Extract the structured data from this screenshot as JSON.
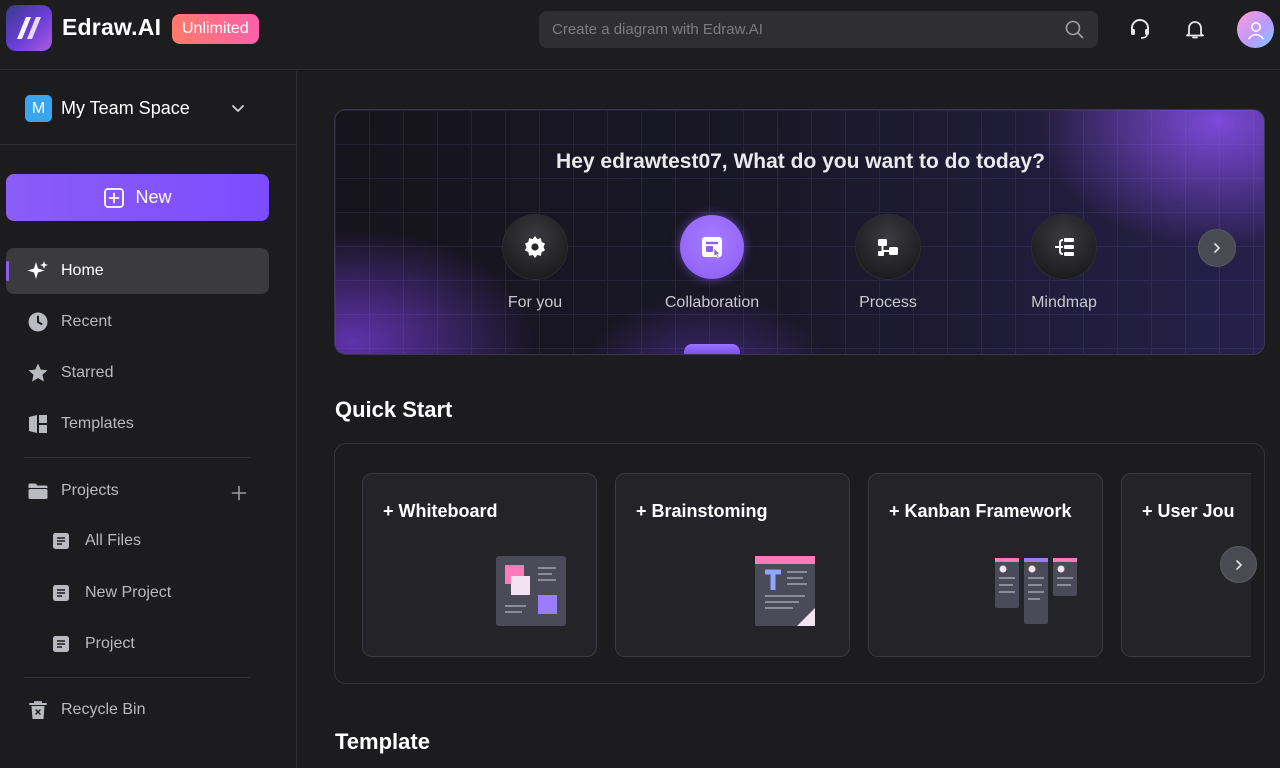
{
  "app": {
    "name": "Edraw.AI",
    "plan_badge": "Unlimited",
    "logo_icon": "edraw-logo-icon"
  },
  "search": {
    "placeholder": "Create a diagram with Edraw.AI",
    "icon": "search-icon"
  },
  "header_icons": [
    "support-headset-icon",
    "notification-bell-icon",
    "user-avatar"
  ],
  "sidebar": {
    "team": {
      "initial": "M",
      "name": "My Team Space"
    },
    "new_button": "New",
    "nav": [
      {
        "label": "Home",
        "icon": "sparkle-icon",
        "active": true
      },
      {
        "label": "Recent",
        "icon": "clock-icon"
      },
      {
        "label": "Starred",
        "icon": "star-icon"
      },
      {
        "label": "Templates",
        "icon": "templates-icon"
      }
    ],
    "projects": {
      "label": "Projects",
      "icon": "folder-icon",
      "items": [
        {
          "label": "All Files",
          "icon": "file-icon"
        },
        {
          "label": "New Project",
          "icon": "file-icon"
        },
        {
          "label": "Project",
          "icon": "file-icon"
        }
      ]
    },
    "recycle_bin": {
      "label": "Recycle Bin",
      "icon": "trash-icon"
    }
  },
  "hero": {
    "greeting": "Hey edrawtest07, What do you want to do today?",
    "features": [
      {
        "label": "For you",
        "icon": "gear-icon",
        "selected": false
      },
      {
        "label": "Collaboration",
        "icon": "collaboration-icon",
        "selected": true
      },
      {
        "label": "Process",
        "icon": "process-icon",
        "selected": false
      },
      {
        "label": "Mindmap",
        "icon": "mindmap-icon",
        "selected": false
      }
    ]
  },
  "quick_start": {
    "title": "Quick Start",
    "cards": [
      {
        "label": "+ Whiteboard"
      },
      {
        "label": "+ Brainstoming"
      },
      {
        "label": "+ Kanban Framework"
      },
      {
        "label": "+ User Jou"
      }
    ]
  },
  "template_section": {
    "title": "Template"
  },
  "colors": {
    "accent": "#8b5cf6",
    "background": "#1c1c1e",
    "badge_gradient_start": "#ff7a6b",
    "badge_gradient_end": "#ff5fa8"
  }
}
